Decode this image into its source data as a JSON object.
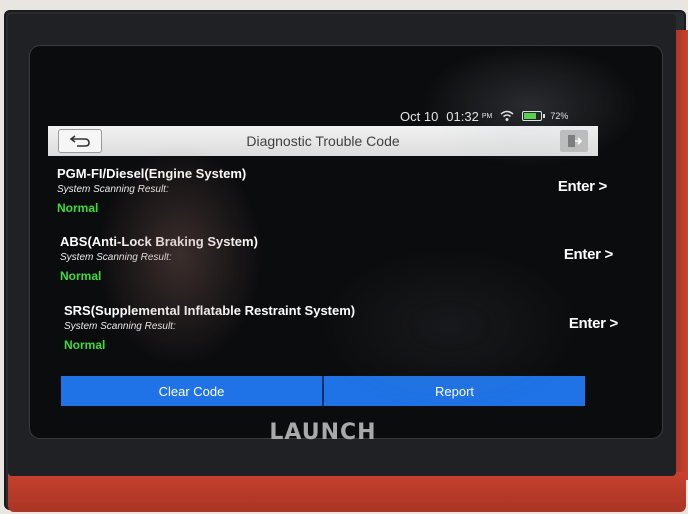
{
  "status_bar": {
    "date": "Oct 10",
    "time": "01:32",
    "ampm": "PM",
    "battery_percent": "72%",
    "battery_level": 0.72,
    "icons": [
      "wifi-icon",
      "battery-icon"
    ]
  },
  "header": {
    "title": "Diagnostic Trouble Code",
    "icons": [
      "back-arrow-icon",
      "exit-icon"
    ]
  },
  "systems": [
    {
      "name": "PGM-FI/Diesel(Engine System)",
      "result_label": "System Scanning Result:",
      "status": "Normal",
      "action": "Enter >"
    },
    {
      "name": "ABS(Anti-Lock Braking System)",
      "result_label": "System Scanning Result:",
      "status": "Normal",
      "action": "Enter >"
    },
    {
      "name": "SRS(Supplemental Inflatable Restraint System)",
      "result_label": "System Scanning Result:",
      "status": "Normal",
      "action": "Enter >"
    }
  ],
  "footer": {
    "clear_code": "Clear Code",
    "report": "Report"
  },
  "brand": "LAUNCH",
  "colors": {
    "accent_blue": "#1f73e6",
    "status_normal": "#3ddc3a",
    "device_red": "#c8412e"
  }
}
